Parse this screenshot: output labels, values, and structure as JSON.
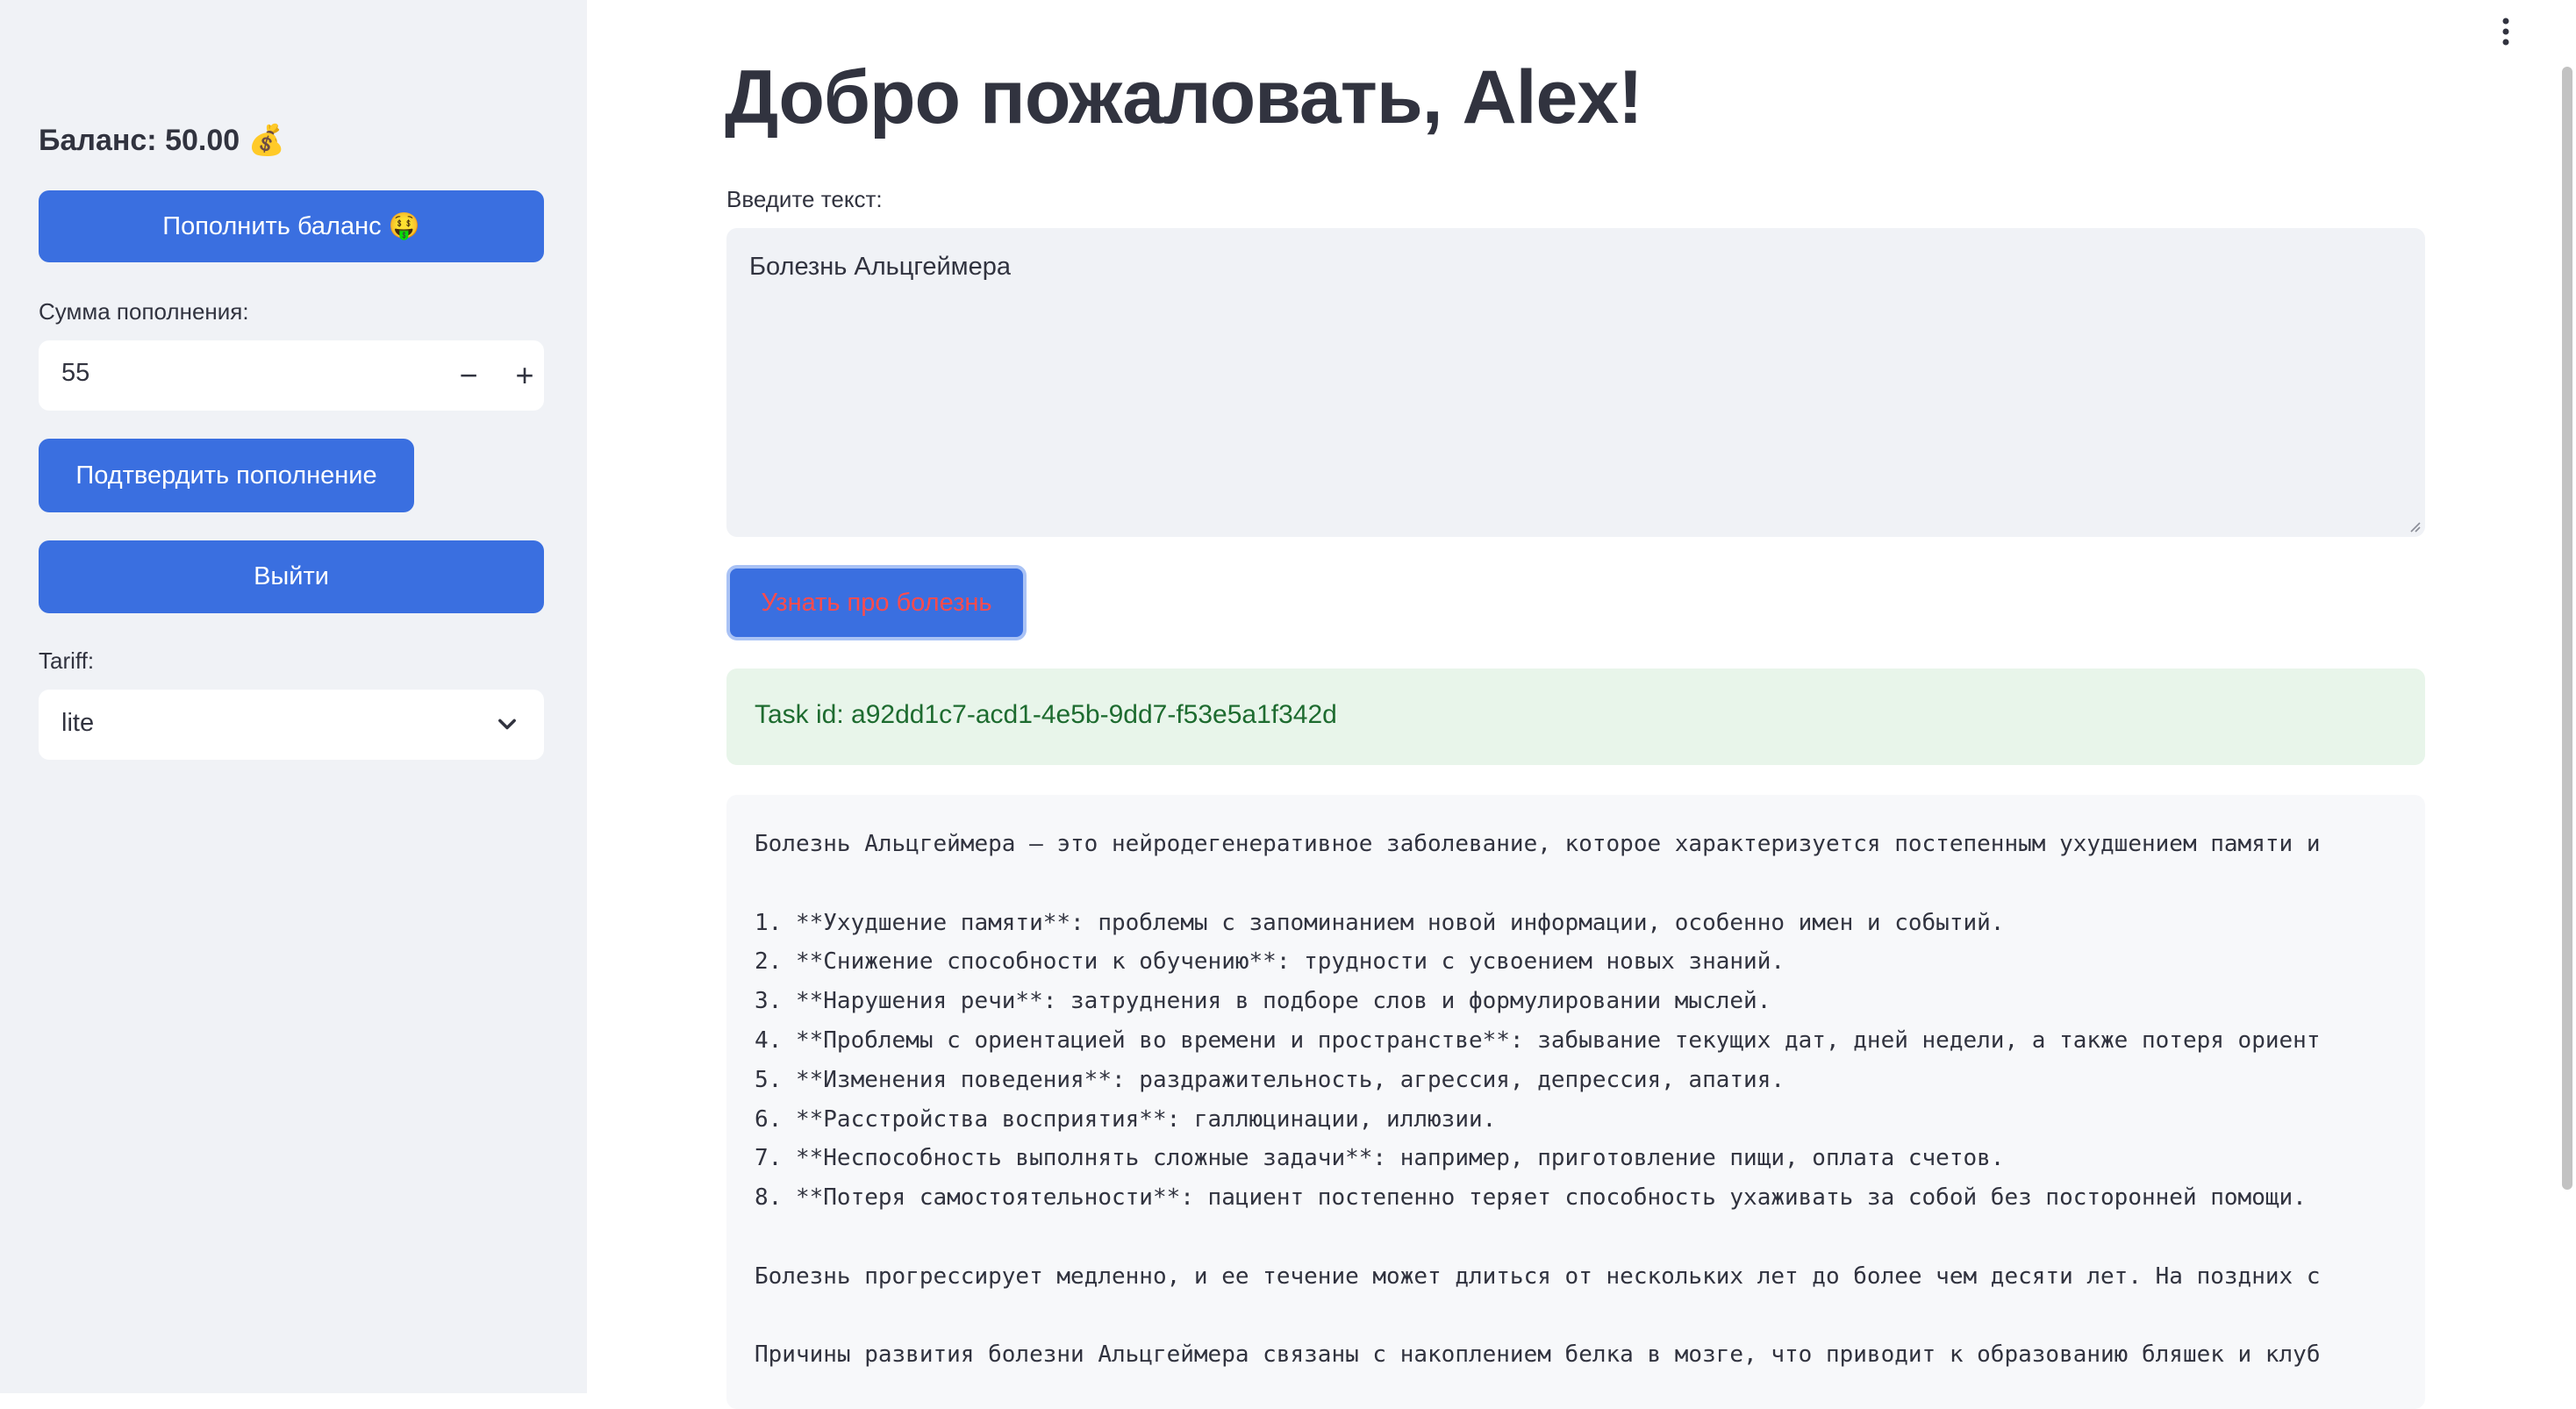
{
  "sidebar": {
    "balance_text": "Баланс: 50.00 💰",
    "topup_button": "Пополнить баланс 🤑",
    "amount_label": "Сумма пополнения:",
    "amount_value": "55",
    "minus": "−",
    "plus": "+",
    "confirm_button": "Подтвердить пополнение",
    "logout_button": "Выйти",
    "tariff_label": "Tariff:",
    "tariff_value": "lite"
  },
  "main": {
    "title": "Добро пожаловать, Alex!",
    "input_label": "Введите текст:",
    "input_value": "Болезнь Альцгеймера",
    "submit_button": "Узнать про болезнь",
    "task_text": "Task id: a92dd1c7-acd1-4e5b-9dd7-f53e5a1f342d",
    "result_lines": [
      "Болезнь Альцгеймера — это нейродегенеративное заболевание, которое характеризуется постепенным ухудшением памяти и",
      "",
      "1. **Ухудшение памяти**: проблемы с запоминанием новой информации, особенно имен и событий.",
      "2. **Снижение способности к обучению**: трудности с усвоением новых знаний.",
      "3. **Нарушения речи**: затруднения в подборе слов и формулировании мыслей.",
      "4. **Проблемы с ориентацией во времени и пространстве**: забывание текущих дат, дней недели, а также потеря ориент",
      "5. **Изменения поведения**: раздражительность, агрессия, депрессия, апатия.",
      "6. **Расстройства восприятия**: галлюцинации, иллюзии.",
      "7. **Неспособность выполнять сложные задачи**: например, приготовление пищи, оплата счетов.",
      "8. **Потеря самостоятельности**: пациент постепенно теряет способность ухаживать за собой без посторонней помощи.",
      "",
      "Болезнь прогрессирует медленно, и ее течение может длиться от нескольких лет до более чем десяти лет. На поздних с",
      "",
      "Причины развития болезни Альцгеймера связаны с накоплением белка в мозге, что приводит к образованию бляшек и клуб"
    ]
  },
  "colors": {
    "primary": "#3a6fe0",
    "sidebar_bg": "#f0f2f6",
    "success_bg": "#e8f5ea",
    "success_text": "#1d6b2f",
    "button_text_accent": "#ff4b4b"
  },
  "icons": {
    "menu": "more-vertical-icon",
    "chevron": "chevron-down-icon"
  }
}
